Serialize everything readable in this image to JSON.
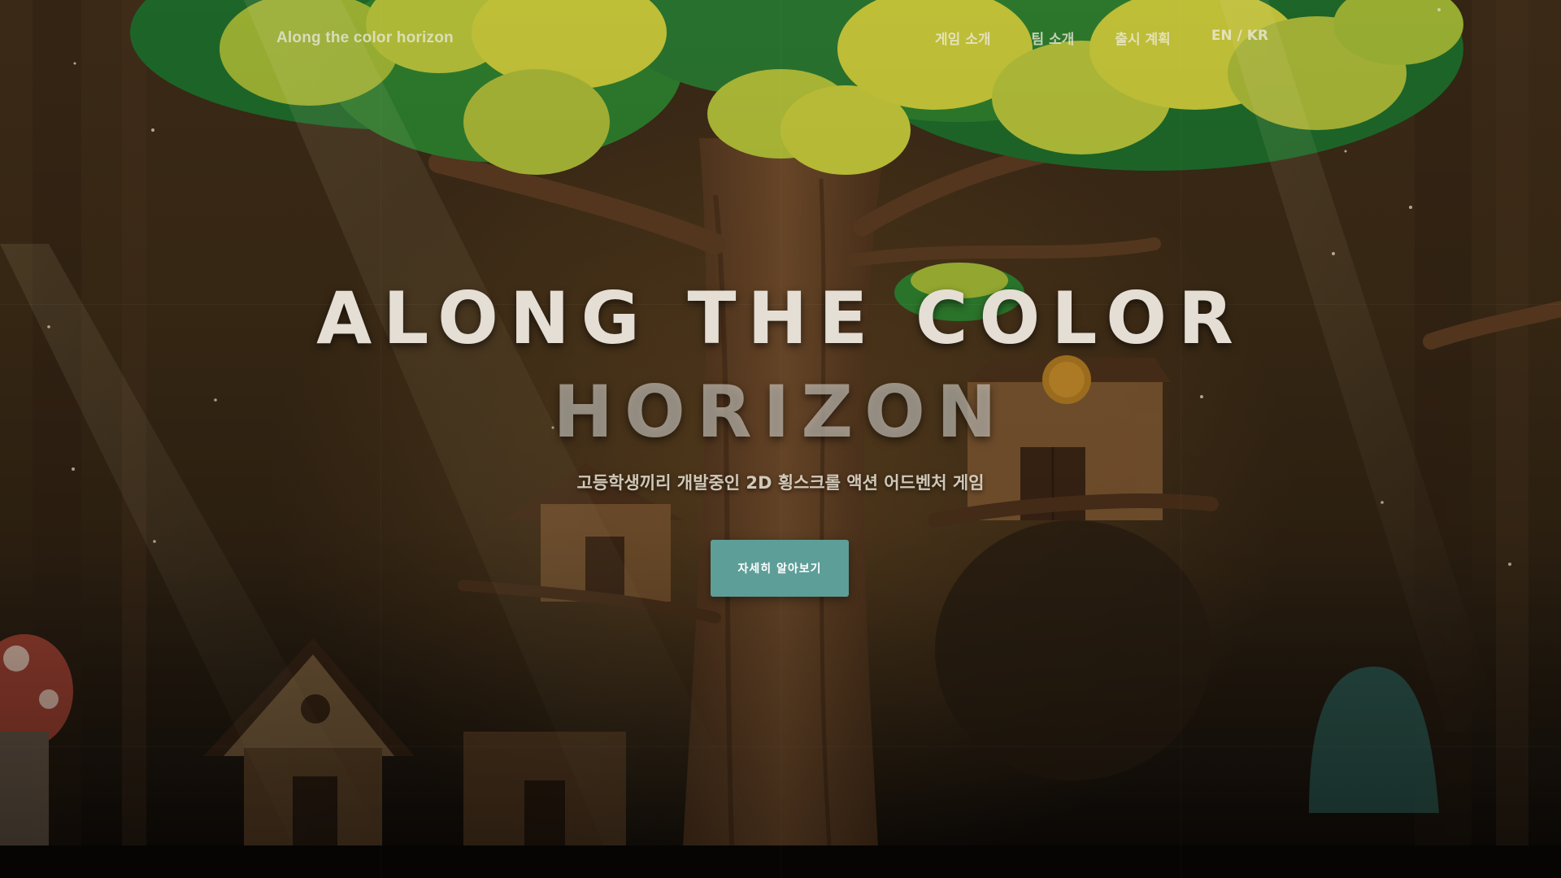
{
  "nav": {
    "brand": "Along the color horizon",
    "links": [
      {
        "label": "게임 소개"
      },
      {
        "label": "팀 소개"
      },
      {
        "label": "출시 계획"
      },
      {
        "label": "EN / KR"
      }
    ]
  },
  "hero": {
    "title_line1": "ALONG THE COLOR",
    "title_line2": "HORIZON",
    "subtitle": "고등학생끼리 개발중인 2D 횡스크롤 액션 어드벤처 게임",
    "cta_label": "자세히 알아보기"
  },
  "colors": {
    "cta_background": "#5e9e98",
    "foliage": "#c8c83a",
    "trunk": "#6a4528",
    "background": "#3a2915"
  }
}
